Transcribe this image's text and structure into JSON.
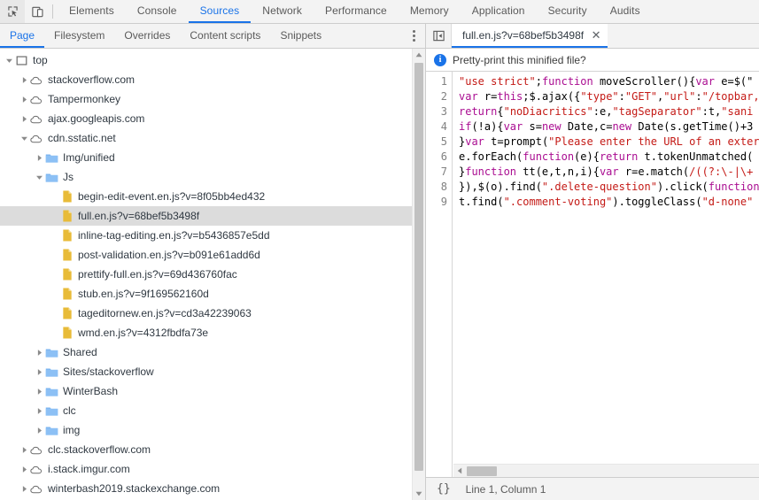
{
  "toolbar": {
    "inspect_icon": "inspect-element-icon",
    "device_icon": "device-toolbar-icon",
    "tabs": [
      {
        "label": "Elements",
        "active": false
      },
      {
        "label": "Console",
        "active": false
      },
      {
        "label": "Sources",
        "active": true
      },
      {
        "label": "Network",
        "active": false
      },
      {
        "label": "Performance",
        "active": false
      },
      {
        "label": "Memory",
        "active": false
      },
      {
        "label": "Application",
        "active": false
      },
      {
        "label": "Security",
        "active": false
      },
      {
        "label": "Audits",
        "active": false
      }
    ],
    "accent_color": "#1a73e8"
  },
  "navigator": {
    "tabs": [
      {
        "label": "Page",
        "active": true
      },
      {
        "label": "Filesystem",
        "active": false
      },
      {
        "label": "Overrides",
        "active": false
      },
      {
        "label": "Content scripts",
        "active": false
      },
      {
        "label": "Snippets",
        "active": false
      }
    ],
    "more_options_icon": "kebab-menu-icon",
    "tree": [
      {
        "label": "top",
        "type": "frame",
        "indent": 0,
        "twisty": "expanded",
        "selected": false
      },
      {
        "label": "stackoverflow.com",
        "type": "domain",
        "indent": 1,
        "twisty": "collapsed",
        "selected": false
      },
      {
        "label": "Tampermonkey",
        "type": "domain",
        "indent": 1,
        "twisty": "collapsed",
        "selected": false
      },
      {
        "label": "ajax.googleapis.com",
        "type": "domain",
        "indent": 1,
        "twisty": "collapsed",
        "selected": false
      },
      {
        "label": "cdn.sstatic.net",
        "type": "domain",
        "indent": 1,
        "twisty": "expanded",
        "selected": false
      },
      {
        "label": "Img/unified",
        "type": "folder",
        "indent": 2,
        "twisty": "collapsed",
        "selected": false
      },
      {
        "label": "Js",
        "type": "folder",
        "indent": 2,
        "twisty": "expanded",
        "selected": false
      },
      {
        "label": "begin-edit-event.en.js?v=8f05bb4ed432",
        "type": "file",
        "indent": 3,
        "twisty": "none",
        "selected": false
      },
      {
        "label": "full.en.js?v=68bef5b3498f",
        "type": "file",
        "indent": 3,
        "twisty": "none",
        "selected": true
      },
      {
        "label": "inline-tag-editing.en.js?v=b5436857e5dd",
        "type": "file",
        "indent": 3,
        "twisty": "none",
        "selected": false
      },
      {
        "label": "post-validation.en.js?v=b091e61add6d",
        "type": "file",
        "indent": 3,
        "twisty": "none",
        "selected": false
      },
      {
        "label": "prettify-full.en.js?v=69d436760fac",
        "type": "file",
        "indent": 3,
        "twisty": "none",
        "selected": false
      },
      {
        "label": "stub.en.js?v=9f169562160d",
        "type": "file",
        "indent": 3,
        "twisty": "none",
        "selected": false
      },
      {
        "label": "tageditornew.en.js?v=cd3a42239063",
        "type": "file",
        "indent": 3,
        "twisty": "none",
        "selected": false
      },
      {
        "label": "wmd.en.js?v=4312fbdfa73e",
        "type": "file",
        "indent": 3,
        "twisty": "none",
        "selected": false
      },
      {
        "label": "Shared",
        "type": "folder",
        "indent": 2,
        "twisty": "collapsed",
        "selected": false
      },
      {
        "label": "Sites/stackoverflow",
        "type": "folder",
        "indent": 2,
        "twisty": "collapsed",
        "selected": false
      },
      {
        "label": "WinterBash",
        "type": "folder",
        "indent": 2,
        "twisty": "collapsed",
        "selected": false
      },
      {
        "label": "clc",
        "type": "folder",
        "indent": 2,
        "twisty": "collapsed",
        "selected": false
      },
      {
        "label": "img",
        "type": "folder",
        "indent": 2,
        "twisty": "collapsed",
        "selected": false
      },
      {
        "label": "clc.stackoverflow.com",
        "type": "domain",
        "indent": 1,
        "twisty": "collapsed",
        "selected": false
      },
      {
        "label": "i.stack.imgur.com",
        "type": "domain",
        "indent": 1,
        "twisty": "collapsed",
        "selected": false
      },
      {
        "label": "winterbash2019.stackexchange.com",
        "type": "domain",
        "indent": 1,
        "twisty": "collapsed",
        "selected": false
      }
    ],
    "scrollbar": {
      "up_arrow_icon": "scroll-up-arrow-icon",
      "down_arrow_icon": "scroll-down-arrow-icon"
    }
  },
  "editor": {
    "show_navigator_icon": "show-navigator-panel-icon",
    "tab": {
      "filename": "full.en.js?v=68bef5b3498f",
      "close_icon": "✕"
    },
    "infobar": {
      "icon": "info-icon",
      "icon_glyph": "i",
      "message": "Pretty-print this minified file?"
    },
    "line_numbers": [
      "1",
      "2",
      "3",
      "4",
      "5",
      "6",
      "7",
      "8",
      "9"
    ],
    "lines": [
      [
        {
          "t": "\"use strict\"",
          "c": "tk-str"
        },
        {
          "t": ";",
          "c": "tk-pln"
        },
        {
          "t": "function",
          "c": "tk-kw"
        },
        {
          "t": " moveScroller(){",
          "c": "tk-pln"
        },
        {
          "t": "var",
          "c": "tk-kw"
        },
        {
          "t": " e=$(\"",
          "c": "tk-pln"
        }
      ],
      [
        {
          "t": "var",
          "c": "tk-kw"
        },
        {
          "t": " r=",
          "c": "tk-pln"
        },
        {
          "t": "this",
          "c": "tk-kw"
        },
        {
          "t": ";$.ajax({",
          "c": "tk-pln"
        },
        {
          "t": "\"type\"",
          "c": "tk-str"
        },
        {
          "t": ":",
          "c": "tk-pln"
        },
        {
          "t": "\"GET\"",
          "c": "tk-str"
        },
        {
          "t": ",",
          "c": "tk-pln"
        },
        {
          "t": "\"url\"",
          "c": "tk-str"
        },
        {
          "t": ":",
          "c": "tk-pln"
        },
        {
          "t": "\"/topbar,",
          "c": "tk-str"
        }
      ],
      [
        {
          "t": "return",
          "c": "tk-kw"
        },
        {
          "t": "{",
          "c": "tk-pln"
        },
        {
          "t": "\"noDiacritics\"",
          "c": "tk-str"
        },
        {
          "t": ":e,",
          "c": "tk-pln"
        },
        {
          "t": "\"tagSeparator\"",
          "c": "tk-str"
        },
        {
          "t": ":t,",
          "c": "tk-pln"
        },
        {
          "t": "\"sani",
          "c": "tk-str"
        }
      ],
      [
        {
          "t": "if",
          "c": "tk-kw"
        },
        {
          "t": "(!a){",
          "c": "tk-pln"
        },
        {
          "t": "var",
          "c": "tk-kw"
        },
        {
          "t": " s=",
          "c": "tk-pln"
        },
        {
          "t": "new",
          "c": "tk-kw"
        },
        {
          "t": " Date,c=",
          "c": "tk-pln"
        },
        {
          "t": "new",
          "c": "tk-kw"
        },
        {
          "t": " Date(s.getTime()+3",
          "c": "tk-pln"
        }
      ],
      [
        {
          "t": "}",
          "c": "tk-pln"
        },
        {
          "t": "var",
          "c": "tk-kw"
        },
        {
          "t": " t=prompt(",
          "c": "tk-pln"
        },
        {
          "t": "\"Please enter the URL of an exter",
          "c": "tk-str"
        }
      ],
      [
        {
          "t": "e.forEach(",
          "c": "tk-pln"
        },
        {
          "t": "function",
          "c": "tk-kw"
        },
        {
          "t": "(e){",
          "c": "tk-pln"
        },
        {
          "t": "return",
          "c": "tk-kw"
        },
        {
          "t": " t.tokenUnmatched(",
          "c": "tk-pln"
        }
      ],
      [
        {
          "t": "}",
          "c": "tk-pln"
        },
        {
          "t": "function",
          "c": "tk-kw"
        },
        {
          "t": " tt(e,t,n,i){",
          "c": "tk-pln"
        },
        {
          "t": "var",
          "c": "tk-kw"
        },
        {
          "t": " r=e.match(",
          "c": "tk-pln"
        },
        {
          "t": "/((?:\\-|\\+",
          "c": "tk-re"
        }
      ],
      [
        {
          "t": "}),$(o).find(",
          "c": "tk-pln"
        },
        {
          "t": "\".delete-question\"",
          "c": "tk-str"
        },
        {
          "t": ").click(",
          "c": "tk-pln"
        },
        {
          "t": "function",
          "c": "tk-kw"
        }
      ],
      [
        {
          "t": "t.find(",
          "c": "tk-pln"
        },
        {
          "t": "\".comment-voting\"",
          "c": "tk-str"
        },
        {
          "t": ").toggleClass(",
          "c": "tk-pln"
        },
        {
          "t": "\"d-none\"",
          "c": "tk-str"
        }
      ]
    ],
    "hscrollbar": {
      "left_arrow_icon": "scroll-left-arrow-icon"
    }
  },
  "statusbar": {
    "pretty_print_icon": "{}",
    "cursor_position": "Line 1, Column 1"
  }
}
